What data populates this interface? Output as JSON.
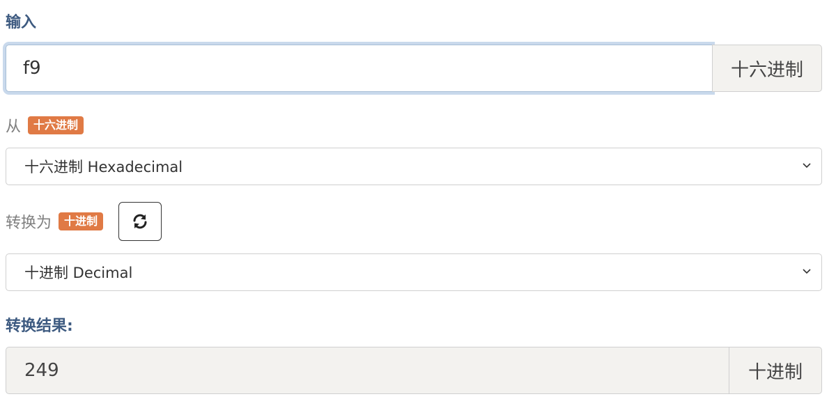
{
  "input_section": {
    "label": "输入",
    "value": "f9",
    "unit": "十六进制"
  },
  "from_section": {
    "label": "从",
    "badge": "十六进制",
    "select_value": "十六进制 Hexadecimal"
  },
  "to_section": {
    "label": "转换为",
    "badge": "十进制",
    "select_value": "十进制 Decimal",
    "swap_icon": "refresh-icon"
  },
  "result_section": {
    "label": "转换结果:",
    "value": "249",
    "unit": "十进制"
  },
  "colors": {
    "accent_label": "#3d5a80",
    "badge": "#e07a45",
    "focus_ring": "#c9d9ec"
  }
}
